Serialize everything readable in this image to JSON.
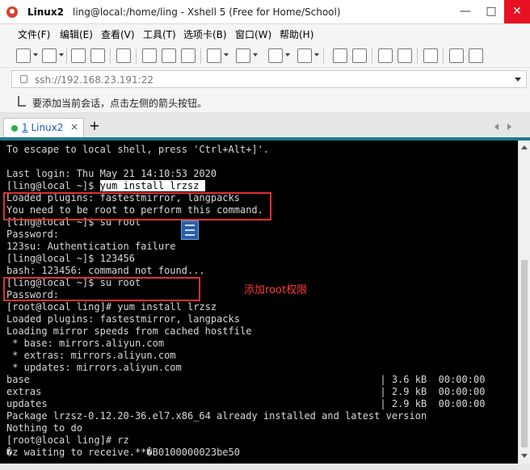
{
  "window": {
    "app_name": "Linux2",
    "title": "ling@local:/home/ling - Xshell 5 (Free for Home/School)",
    "minimize": "—",
    "maximize": "□",
    "close": "✕"
  },
  "menu": {
    "items": [
      "文件(F)",
      "编辑(E)",
      "查看(V)",
      "工具(T)",
      "选项卡(B)",
      "窗口(W)",
      "帮助(H)"
    ]
  },
  "toolbar": {
    "icons": [
      "new-session-icon",
      "open-folder-icon",
      "reconnect-icon",
      "disconnect-icon",
      "properties-icon",
      "copy-icon",
      "paste-icon",
      "find-icon",
      "print-icon",
      "transfer-icon",
      "globe-icon",
      "font-icon",
      "xftp-icon",
      "compose-icon",
      "fullscreen-icon",
      "lock-icon",
      "keyboard-icon",
      "help-icon",
      "chat-icon"
    ]
  },
  "address": {
    "value": "ssh://192.168.23.191:22"
  },
  "infobar": {
    "text": "要添加当前会话，点击左侧的箭头按钮。"
  },
  "tabs": [
    {
      "number": "1",
      "label": "Linux2",
      "close": "×"
    }
  ],
  "tab_add": "+",
  "terminal": {
    "lines": [
      "To escape to local shell, press 'Ctrl+Alt+]'.",
      "",
      "Last login: Thu May 21 14:10:53 2020",
      "[ling@local ~]$ ",
      "Loaded plugins: fastestmirror, langpacks",
      "You need to be root to perform this command.",
      "[ling@local ~]$ su root",
      "Password:",
      "123su: Authentication failure",
      "[ling@local ~]$ 123456",
      "bash: 123456: command not found...",
      "[ling@local ~]$ su root",
      "Password:",
      "[root@local ling]# yum install lrzsz",
      "Loaded plugins: fastestmirror, langpacks",
      "Loading mirror speeds from cached hostfile",
      " * base: mirrors.aliyun.com",
      " * extras: mirrors.aliyun.com",
      " * updates: mirrors.aliyun.com",
      "base                                                            | 3.6 kB  00:00:00",
      "extras                                                          | 2.9 kB  00:00:00",
      "updates                                                         | 2.9 kB  00:00:00",
      "Package lrzsz-0.12.20-36.el7.x86_64 already installed and latest version",
      "Nothing to do",
      "[root@local ling]# rz",
      "�z waiting to receive.**�B0100000023be50"
    ],
    "highlighted_command": "yum install lrzsz ",
    "annotation": "添加root权限"
  },
  "colors": {
    "terminal_bg": "#000000",
    "terminal_fg": "#d8d8d8",
    "annotation": "#e03030",
    "tab_accent": "#1e7a8c"
  }
}
